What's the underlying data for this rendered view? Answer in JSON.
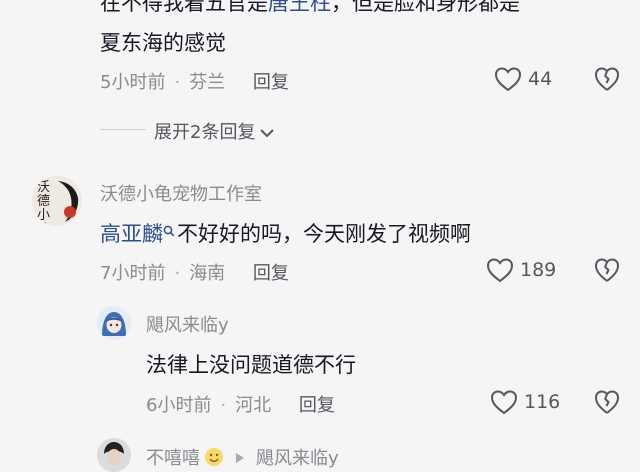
{
  "comments": [
    {
      "text_line1_start": "在不得我着五官是",
      "text_line1_mention": "唐王柱",
      "text_line1_end": "，但是脸和身形都是",
      "text_line2": "夏东海的感觉",
      "time": "5小时前",
      "location": "芬兰",
      "reply_label": "回复",
      "like_count": "44"
    },
    {
      "username": "沃德小龟宠物工作室",
      "avatar_text": "沃德小龟",
      "mention": "高亚麟",
      "text": "不好好的吗，今天刚发了视频啊",
      "time": "7小时前",
      "location": "海南",
      "reply_label": "回复",
      "like_count": "189"
    }
  ],
  "expand_replies": "展开2条回复",
  "reply": {
    "username": "飓风来临y",
    "text": "法律上没问题道德不行",
    "time": "6小时前",
    "location": "河北",
    "reply_label": "回复",
    "like_count": "116"
  },
  "next": {
    "username": "不嘻嘻",
    "target": "飓风来临y"
  },
  "colors": {
    "background": "#f5f5f6",
    "mention": "#2f4d87",
    "meta": "#8a8b91"
  }
}
